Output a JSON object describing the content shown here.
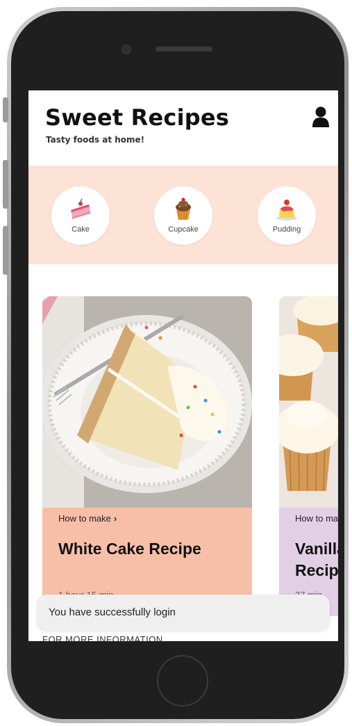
{
  "app": {
    "title": "Sweet Recipes",
    "subtitle": "Tasty foods at home!",
    "profile_icon": "user-icon"
  },
  "categories": [
    {
      "label": "Cake",
      "icon": "cake-icon"
    },
    {
      "label": "Cupcake",
      "icon": "cupcake-icon"
    },
    {
      "label": "Pudding",
      "icon": "pudding-icon"
    }
  ],
  "cards": [
    {
      "how_to": "How to make",
      "chevron": "›",
      "title": "White Cake Recipe",
      "time": "1 hour 15 min",
      "bg": "#f8bfa8"
    },
    {
      "how_to": "How to make",
      "chevron": "›",
      "title": "Vanilla Cupcake Recipe",
      "time": "27 min",
      "bg": "#e3cfe5"
    }
  ],
  "footer": {
    "more_info": "FOR MORE INFORMATION"
  },
  "toast": {
    "message": "You have successfully login"
  },
  "colors": {
    "category_band": "#fde3d6",
    "card1": "#f8bfa8",
    "card2": "#e3cfe5",
    "toast_bg": "#efefef"
  }
}
